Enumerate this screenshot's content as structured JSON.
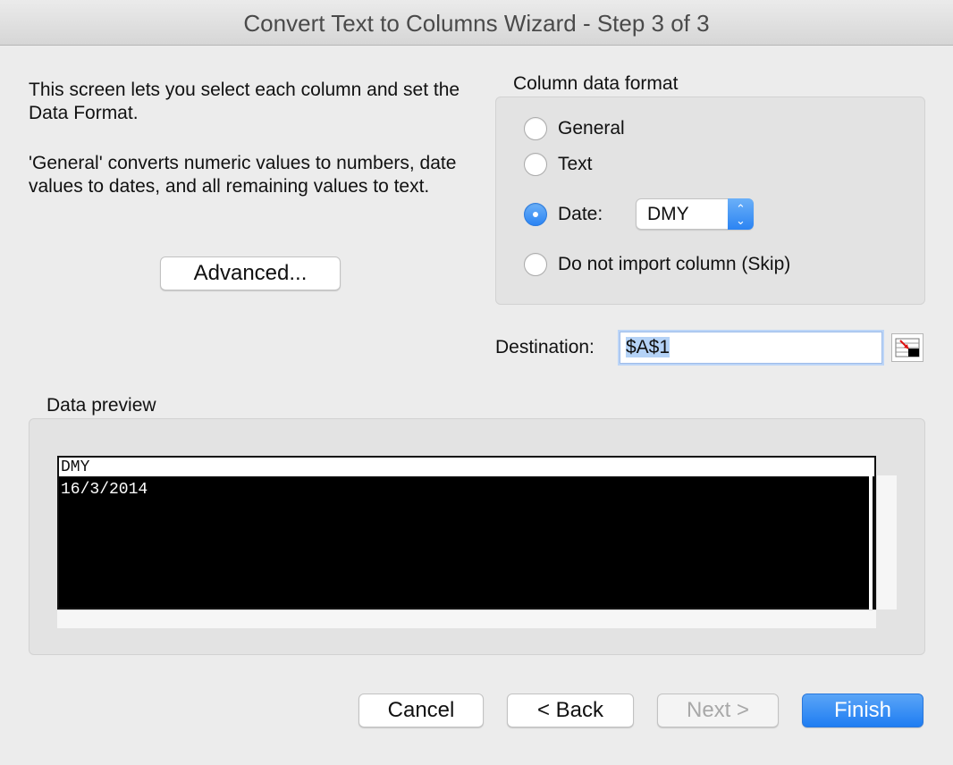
{
  "window": {
    "title": "Convert Text to Columns Wizard - Step 3 of 3"
  },
  "intro": {
    "paragraph1": "This screen lets you select each column and set the Data Format.",
    "paragraph2": "'General' converts numeric values to numbers, date values to dates, and all remaining values to text."
  },
  "buttons": {
    "advanced": "Advanced...",
    "cancel": "Cancel",
    "back": "< Back",
    "next": "Next >",
    "finish": "Finish"
  },
  "column_format": {
    "label": "Column data format",
    "options": [
      {
        "label": "General",
        "selected": false
      },
      {
        "label": "Text",
        "selected": false
      },
      {
        "label": "Date:",
        "selected": true
      },
      {
        "label": "Do not import column (Skip)",
        "selected": false
      }
    ],
    "date_format_value": "DMY"
  },
  "destination": {
    "label": "Destination:",
    "value": "$A$1"
  },
  "preview": {
    "label": "Data preview",
    "header": "DMY",
    "rows": [
      "16/3/2014"
    ]
  }
}
